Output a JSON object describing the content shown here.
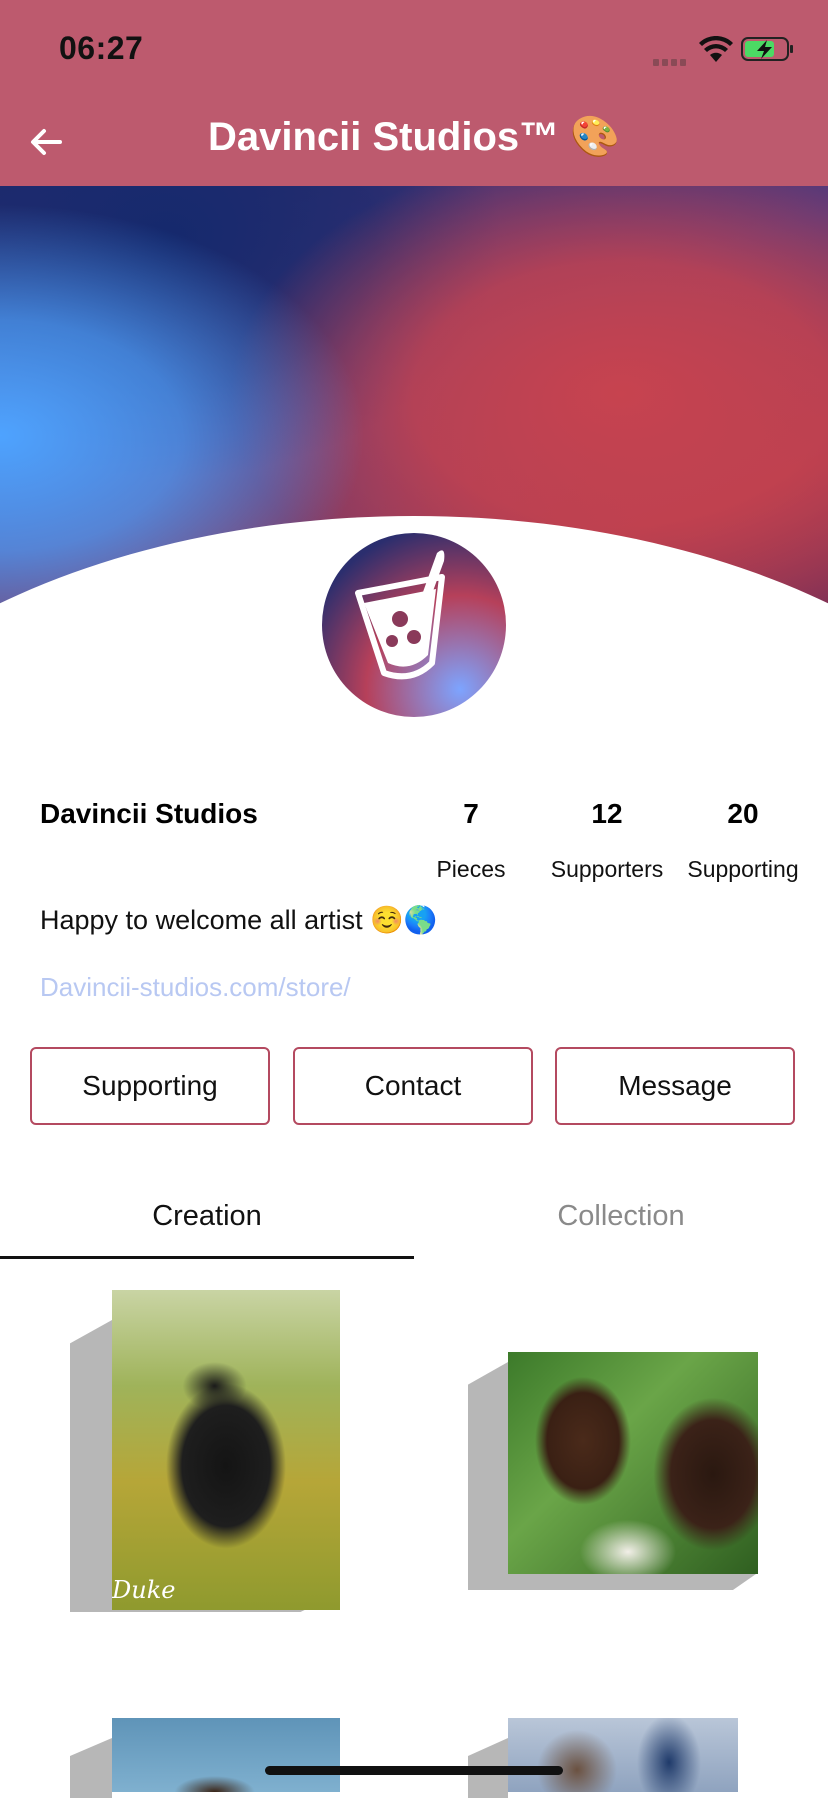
{
  "status_bar": {
    "time": "06:27"
  },
  "header": {
    "title": "Davincii Studios™ 🎨"
  },
  "profile": {
    "name": "Davincii Studios",
    "stats": [
      {
        "value": "7",
        "label": "Pieces"
      },
      {
        "value": "12",
        "label": "Supporters"
      },
      {
        "value": "20",
        "label": "Supporting"
      }
    ],
    "bio": "Happy to welcome all artist ☺️🌎",
    "link": "Davincii-studios.com/store/"
  },
  "actions": {
    "supporting": "Supporting",
    "contact": "Contact",
    "message": "Message"
  },
  "tabs": [
    {
      "label": "Creation",
      "active": true
    },
    {
      "label": "Collection",
      "active": false
    }
  ],
  "artworks": [
    {
      "signature": "Duke"
    },
    {},
    {},
    {}
  ],
  "colors": {
    "header": "#bd5a6e",
    "button_border": "#b44a60",
    "link": "#b8c8f2"
  }
}
